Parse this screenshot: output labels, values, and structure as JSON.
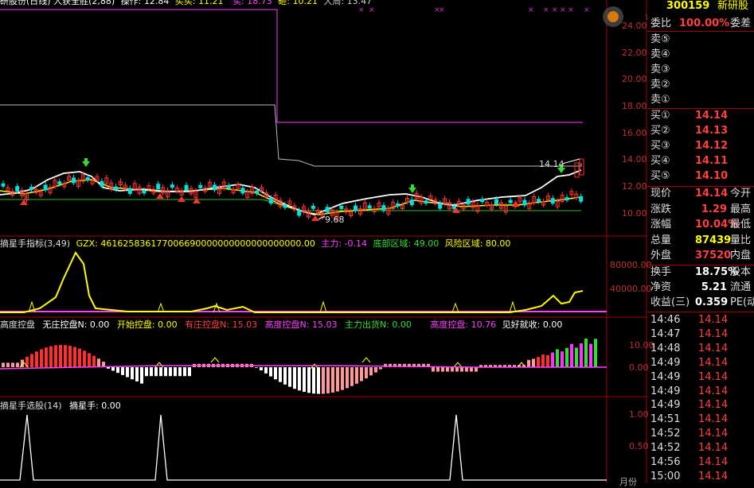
{
  "colors": {
    "up": "#ff3030",
    "down": "#00e0e0",
    "ma": "#ffff00",
    "close": "#ffffff",
    "purple": "#cc33cc",
    "axis": "#c03030"
  },
  "main": {
    "header": [
      "研股份(日线) 人获全胜(2,88)",
      "操作: 12.84",
      "买买: 11.21",
      "买: 18.73",
      "砸: 10.21",
      "大周: 13.47"
    ],
    "y_ticks": [
      "24.00",
      "22.00",
      "20.00",
      "18.00",
      "16.00",
      "14.00",
      "12.00",
      "10.00"
    ],
    "label_max": "14.14",
    "label_min": "9.68"
  },
  "panel2": {
    "header": [
      "摘星手指标(3,49)",
      "GZX: 461625836177006690000000000000000000.00",
      "主力: -0.14",
      "底部区域: 49.00",
      "风险区域: 80.00"
    ],
    "y_ticks": [
      "80000.00",
      "40000.00"
    ]
  },
  "panel3": {
    "header": [
      "高度控盘",
      "无庄控盘N: 0.00",
      "开始控盘: 0.00",
      "有庄控盘N: 15.03",
      "高度控盘N: 15.03",
      "主力出货N: 0.00",
      "高度控盘: 10.76",
      "见好就收: 0.00"
    ],
    "y_ticks": [
      "10.00",
      "0.00"
    ]
  },
  "panel4": {
    "header": [
      "摘星手选股(14)",
      "摘星手: 0.00"
    ],
    "y_ticks": [
      "1.00",
      "0.50"
    ],
    "bottom_label": "月份"
  },
  "quote": {
    "code": "300159",
    "name": "新研股",
    "ratio_label": "委比",
    "ratio_value": "100.00%",
    "ratio_cut": "委差",
    "sells": [
      {
        "label": "卖⑤",
        "price": ""
      },
      {
        "label": "卖④",
        "price": ""
      },
      {
        "label": "卖③",
        "price": ""
      },
      {
        "label": "卖②",
        "price": ""
      },
      {
        "label": "卖①",
        "price": ""
      }
    ],
    "buys": [
      {
        "label": "买①",
        "price": "14.14"
      },
      {
        "label": "买②",
        "price": "14.13"
      },
      {
        "label": "买③",
        "price": "14.12"
      },
      {
        "label": "买④",
        "price": "14.11"
      },
      {
        "label": "买⑤",
        "price": "14.10"
      }
    ],
    "stats": [
      {
        "label": "现价",
        "value": "14.14",
        "cut": "今开",
        "color": "#ff4040"
      },
      {
        "label": "涨跌",
        "value": "1.29",
        "cut": "最高",
        "color": "#ff4040"
      },
      {
        "label": "涨幅",
        "value": "10.04%",
        "cut": "最低",
        "color": "#ff4040"
      },
      {
        "label": "总量",
        "value": "87439",
        "cut": "量比",
        "color": "#ffff00"
      },
      {
        "label": "外盘",
        "value": "37520",
        "cut": "内盘",
        "color": "#ff4040"
      },
      {
        "label": "换手",
        "value": "18.75%",
        "cut": "股本",
        "color": "#ffffff"
      },
      {
        "label": "净资",
        "value": "5.21",
        "cut": "流通",
        "color": "#ffffff"
      },
      {
        "label": "收益(三)",
        "value": "0.359",
        "cut": "PE(动",
        "color": "#ffffff"
      }
    ],
    "ticks": [
      {
        "time": "14:46",
        "price": "14.14"
      },
      {
        "time": "14:47",
        "price": "14.14"
      },
      {
        "time": "14:48",
        "price": "14.14"
      },
      {
        "time": "14:49",
        "price": "14.14"
      },
      {
        "time": "14:49",
        "price": "14.14"
      },
      {
        "time": "14:49",
        "price": "14.14"
      },
      {
        "time": "14:49",
        "price": "14.14"
      },
      {
        "time": "14:51",
        "price": "14.14"
      },
      {
        "time": "14:52",
        "price": "14.14"
      },
      {
        "time": "14:52",
        "price": "14.14"
      },
      {
        "time": "14:56",
        "price": "14.14"
      },
      {
        "time": "15:00",
        "price": "14.14"
      }
    ]
  }
}
